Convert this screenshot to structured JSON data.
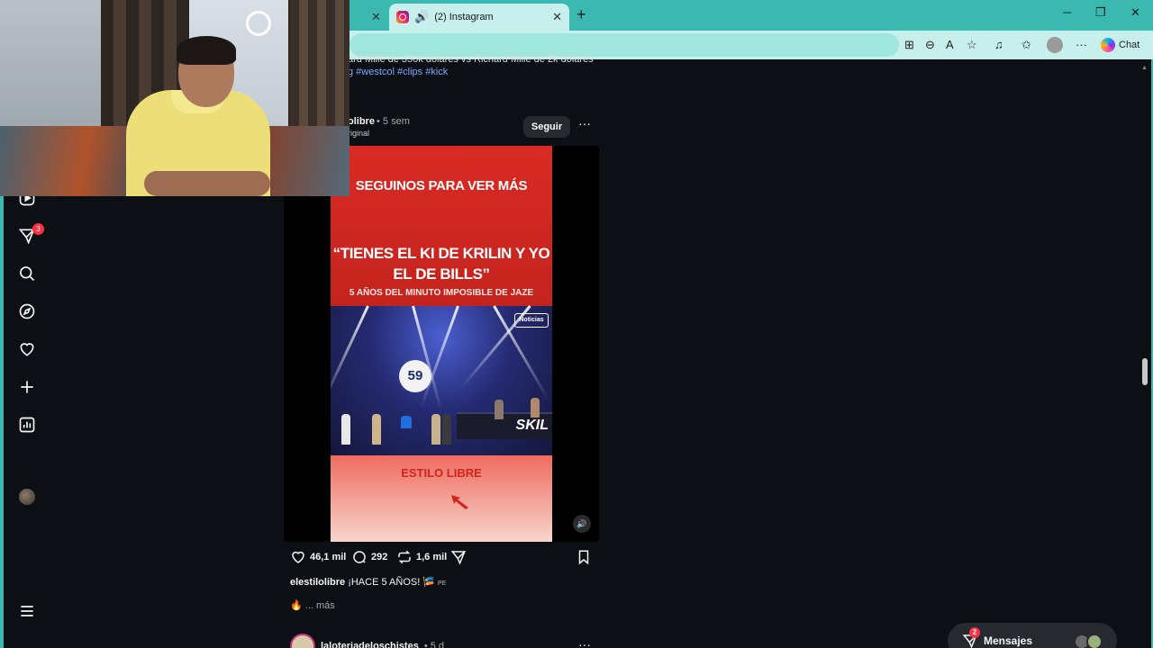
{
  "browser": {
    "prev_tab_close": "✕",
    "active_tab": {
      "title": "(2) Instagram",
      "close": "✕"
    },
    "new_tab": "+",
    "window_controls": [
      "─",
      "❐",
      "✕"
    ],
    "toolbar_more": "···",
    "chat_label": "Chat"
  },
  "nav": {
    "items": [
      {
        "icon": "reels-icon"
      },
      {
        "icon": "send-icon",
        "badge": "3"
      },
      {
        "icon": "search-icon"
      },
      {
        "icon": "explore-icon"
      },
      {
        "icon": "heart-icon"
      },
      {
        "icon": "create-icon"
      },
      {
        "icon": "dashboard-icon"
      },
      {
        "icon": "profile-avatar"
      },
      {
        "icon": "menu-icon"
      }
    ]
  },
  "prev_post": {
    "caption": "ard Mille de 350k dólares vs Richard Mille de 2k dólares",
    "tags": "g #westcol #clips #kick"
  },
  "post": {
    "username": "olibre",
    "time": "• 5 sem",
    "audio": "riginal",
    "follow_label": "Seguir",
    "more": "···",
    "video": {
      "headline": "SEGUINOS PARA VER MÁS",
      "quote": "“TIENES EL KI DE KRILIN Y YO EL DE BILLS”",
      "subline": "5 AÑOS DEL MINUTO IMPOSIBLE DE JAZE",
      "timer": "59",
      "banner_text": "SKIL",
      "corner_logo": "Noticias",
      "brand": "ESTILO LIBRE",
      "sound": "🔊"
    },
    "likes": "46,1 mil",
    "comments": "292",
    "reposts": "1,6 mil",
    "caption_user": "elestilolibre",
    "caption_text": "¡HACE 5 AÑOS!",
    "caption_flag": "PE",
    "more_label": "... más"
  },
  "next_post": {
    "username": "laloteriadeloschistes",
    "time": "• 5 d",
    "more": "···"
  },
  "messages": {
    "label": "Mensajes",
    "badge": "2"
  },
  "colors": {
    "browser_accent": "#3bb8b0",
    "ig_background": "#0c1014",
    "notification_red": "#ff3040"
  }
}
